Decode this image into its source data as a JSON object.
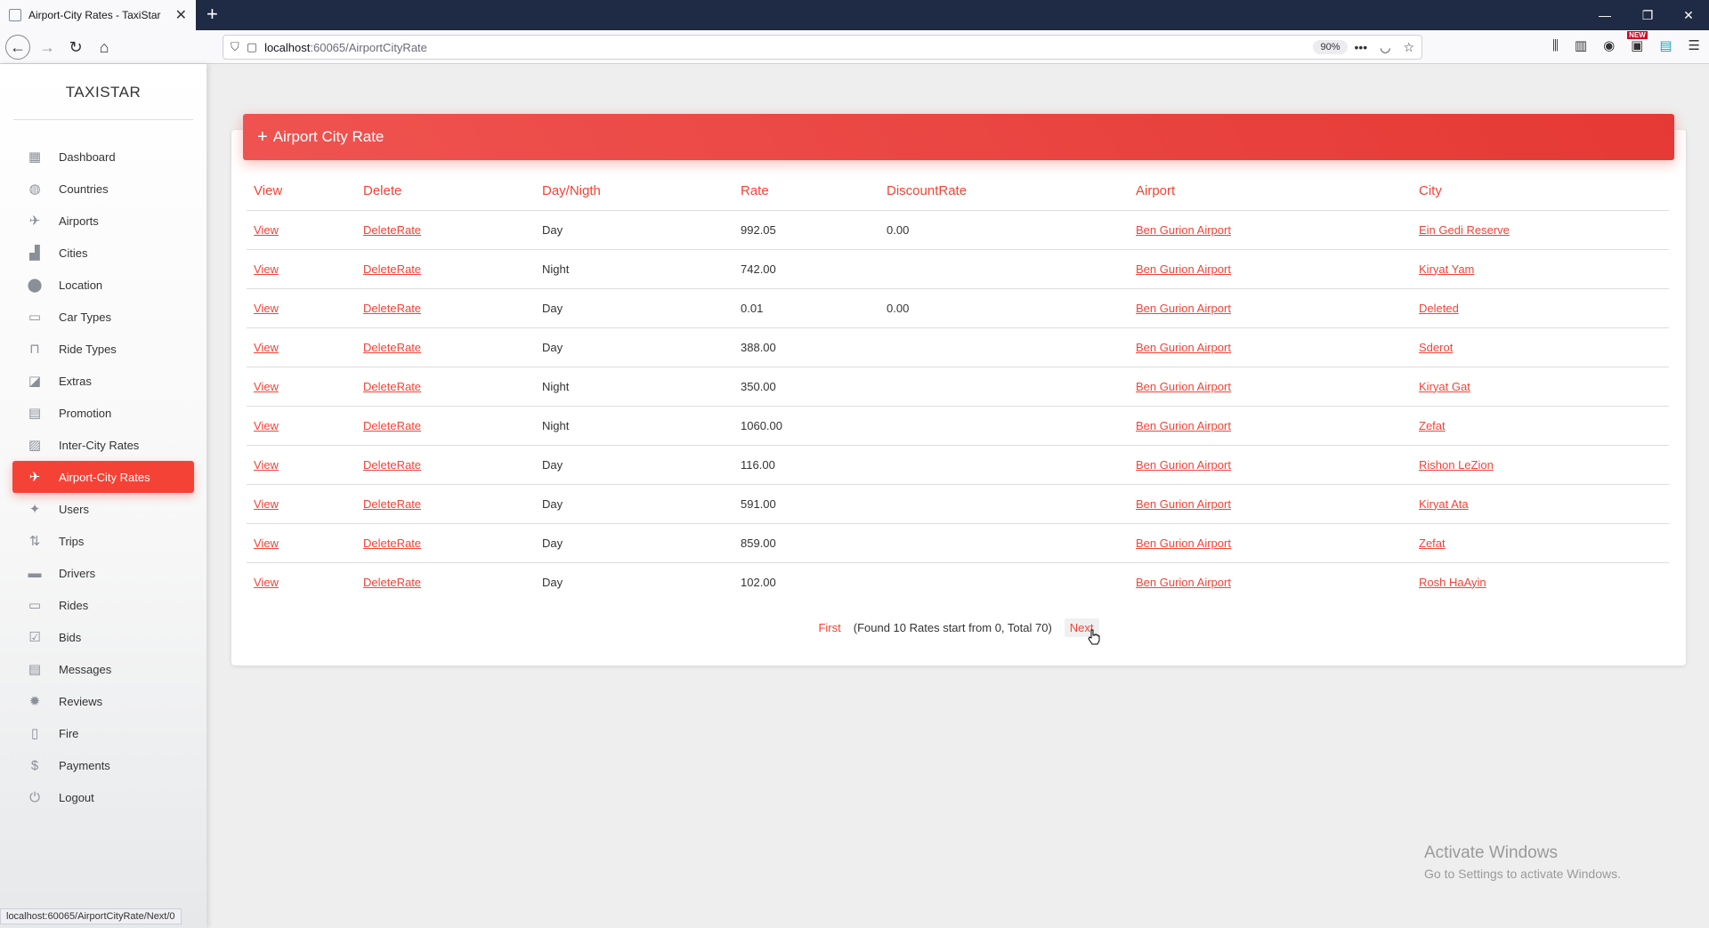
{
  "browser": {
    "tab_title": "Airport-City Rates - TaxiStar",
    "url_host": "localhost",
    "url_path": ":60065/AirportCityRate",
    "zoom": "90%",
    "status_url": "localhost:60065/AirportCityRate/Next/0",
    "new_badge": "NEW"
  },
  "sidebar": {
    "brand": "TAXISTAR",
    "items": [
      {
        "label": "Dashboard",
        "icon": "dashboard-icon",
        "glyph": "▦"
      },
      {
        "label": "Countries",
        "icon": "globe-icon",
        "glyph": "◍"
      },
      {
        "label": "Airports",
        "icon": "airplane-icon",
        "glyph": "✈"
      },
      {
        "label": "Cities",
        "icon": "city-icon",
        "glyph": "▟"
      },
      {
        "label": "Location",
        "icon": "location-pin-icon",
        "glyph": "⬤"
      },
      {
        "label": "Car Types",
        "icon": "shuttle-icon",
        "glyph": "▭"
      },
      {
        "label": "Ride Types",
        "icon": "seat-icon",
        "glyph": "⊓"
      },
      {
        "label": "Extras",
        "icon": "extras-icon",
        "glyph": "◪"
      },
      {
        "label": "Promotion",
        "icon": "promotion-icon",
        "glyph": "▤"
      },
      {
        "label": "Inter-City Rates",
        "icon": "inter-city-icon",
        "glyph": "▨"
      },
      {
        "label": "Airport-City Rates",
        "icon": "flight-takeoff-icon",
        "glyph": "✈"
      },
      {
        "label": "Users",
        "icon": "user-icon",
        "glyph": "✦"
      },
      {
        "label": "Trips",
        "icon": "trips-icon",
        "glyph": "⇅"
      },
      {
        "label": "Drivers",
        "icon": "car-icon",
        "glyph": "▬"
      },
      {
        "label": "Rides",
        "icon": "bus-icon",
        "glyph": "▭"
      },
      {
        "label": "Bids",
        "icon": "check-box-icon",
        "glyph": "☑"
      },
      {
        "label": "Messages",
        "icon": "message-icon",
        "glyph": "▤"
      },
      {
        "label": "Reviews",
        "icon": "reviews-icon",
        "glyph": "✹"
      },
      {
        "label": "Fire",
        "icon": "clipboard-icon",
        "glyph": "▯"
      },
      {
        "label": "Payments",
        "icon": "dollar-icon",
        "glyph": "$"
      },
      {
        "label": "Logout",
        "icon": "plug-icon",
        "glyph": "⏻"
      }
    ]
  },
  "card": {
    "header": "Airport City Rate",
    "columns": [
      "View",
      "Delete",
      "Day/Nigth",
      "Rate",
      "DiscountRate",
      "Airport",
      "City"
    ],
    "rows": [
      {
        "view": "View",
        "delete": "DeleteRate",
        "day_night": "Day",
        "rate": "992.05",
        "discount": "0.00",
        "airport": "Ben Gurion Airport",
        "city": "Ein Gedi Reserve"
      },
      {
        "view": "View",
        "delete": "DeleteRate",
        "day_night": "Night",
        "rate": "742.00",
        "discount": "",
        "airport": "Ben Gurion Airport",
        "city": "Kiryat Yam"
      },
      {
        "view": "View",
        "delete": "DeleteRate",
        "day_night": "Day",
        "rate": "0.01",
        "discount": "0.00",
        "airport": "Ben Gurion Airport",
        "city": "Deleted"
      },
      {
        "view": "View",
        "delete": "DeleteRate",
        "day_night": "Day",
        "rate": "388.00",
        "discount": "",
        "airport": "Ben Gurion Airport",
        "city": "Sderot"
      },
      {
        "view": "View",
        "delete": "DeleteRate",
        "day_night": "Night",
        "rate": "350.00",
        "discount": "",
        "airport": "Ben Gurion Airport",
        "city": "Kiryat Gat"
      },
      {
        "view": "View",
        "delete": "DeleteRate",
        "day_night": "Night",
        "rate": "1060.00",
        "discount": "",
        "airport": "Ben Gurion Airport",
        "city": "Zefat"
      },
      {
        "view": "View",
        "delete": "DeleteRate",
        "day_night": "Day",
        "rate": "116.00",
        "discount": "",
        "airport": "Ben Gurion Airport",
        "city": "Rishon LeZion"
      },
      {
        "view": "View",
        "delete": "DeleteRate",
        "day_night": "Day",
        "rate": "591.00",
        "discount": "",
        "airport": "Ben Gurion Airport",
        "city": "Kiryat Ata"
      },
      {
        "view": "View",
        "delete": "DeleteRate",
        "day_night": "Day",
        "rate": "859.00",
        "discount": "",
        "airport": "Ben Gurion Airport",
        "city": "Zefat"
      },
      {
        "view": "View",
        "delete": "DeleteRate",
        "day_night": "Day",
        "rate": "102.00",
        "discount": "",
        "airport": "Ben Gurion Airport",
        "city": "Rosh HaAyin"
      }
    ]
  },
  "pager": {
    "first": "First",
    "info": "(Found 10 Rates start from 0, Total 70)",
    "next": "Next"
  },
  "watermark": {
    "line1": "Activate Windows",
    "line2": "Go to Settings to activate Windows."
  },
  "colors": {
    "accent": "#f44336",
    "titlebar": "#1f2a44"
  }
}
